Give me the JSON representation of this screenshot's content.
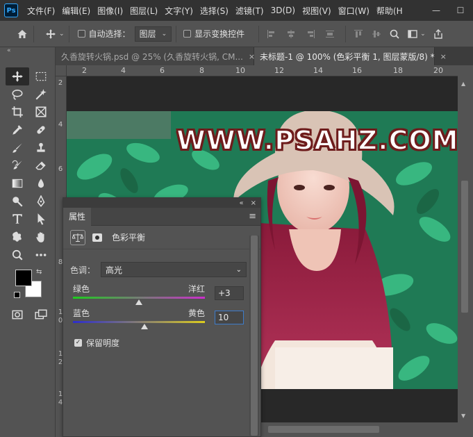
{
  "app": {
    "logo": "Ps"
  },
  "menu": [
    "文件(F)",
    "编辑(E)",
    "图像(I)",
    "图层(L)",
    "文字(Y)",
    "选择(S)",
    "滤镜(T)",
    "3D(D)",
    "视图(V)",
    "窗口(W)",
    "帮助(H"
  ],
  "window_controls": {
    "minimize": "—",
    "maximize": "☐"
  },
  "options_bar": {
    "auto_select_label": "自动选择：",
    "layer_select_value": "图层",
    "show_transform_label": "显示变换控件"
  },
  "toolbar_header": "«",
  "tabs": [
    {
      "label": "久香旋转火锅.psd @ 25% (久香旋转火锅, CM...",
      "close": "×"
    },
    {
      "label": "未标题-1 @ 100% (色彩平衡 1, 图层蒙版/8) *",
      "close": "×"
    }
  ],
  "ruler_top": [
    "2",
    "4",
    "6",
    "8",
    "10",
    "12",
    "14",
    "16",
    "18",
    "20"
  ],
  "ruler_left": [
    "2",
    "4",
    "6",
    "8",
    "1\n0",
    "1\n2",
    "1\n4"
  ],
  "canvas": {
    "watermark": "WWW.PSAHZ.COM"
  },
  "panel": {
    "top_controls": [
      "«",
      "×"
    ],
    "tab_label": "属性",
    "menu_icon": "≡",
    "adjustment_title": "色彩平衡",
    "tone_label": "色调：",
    "tone_value": "高光",
    "slider1": {
      "left": "绿色",
      "right": "洋红",
      "value": "+3",
      "position": 0.5
    },
    "slider2": {
      "left": "蓝色",
      "right": "黄色",
      "value": "10",
      "position": 0.54
    },
    "preserve_label": "保留明度"
  },
  "colors": {
    "foreground": "#000000",
    "background": "#ffffff",
    "accent": "#3d7ccb"
  }
}
